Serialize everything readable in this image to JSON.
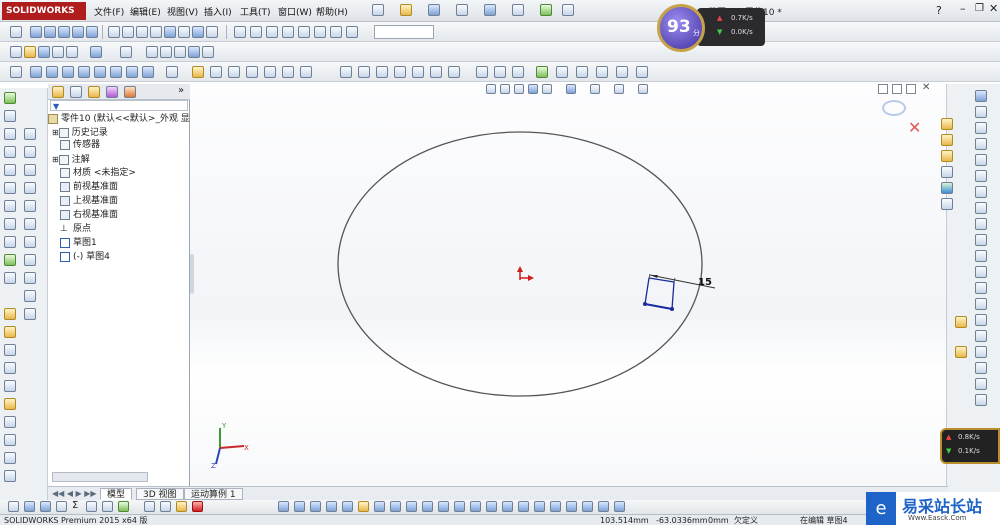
{
  "app": {
    "logo_text": "SOLIDWORKS",
    "window_title": "草图4 ← 零件10 *"
  },
  "menus": [
    "文件(F)",
    "编辑(E)",
    "视图(V)",
    "插入(I)",
    "工具(T)",
    "窗口(W)",
    "帮助(H)"
  ],
  "speed_widget": {
    "score": "93",
    "score_unit": "分",
    "up": "0.7K/s",
    "down": "0.0K/s"
  },
  "speed_widget_2": {
    "up": "0.8K/s",
    "down": "0.1K/s"
  },
  "tree": {
    "filter_label": "",
    "root": "零件10  (默认<<默认>_外观 显",
    "nodes": [
      "历史记录",
      "传感器",
      "注解",
      "材质 <未指定>",
      "前视基准面",
      "上视基准面",
      "右视基准面",
      "原点",
      "草图1",
      "(-) 草图4"
    ]
  },
  "sketch": {
    "dimension_label": "15"
  },
  "bottom_tabs": [
    "模型",
    "3D 视图",
    "运动算例 1"
  ],
  "status": {
    "product": "SOLIDWORKS Premium 2015 x64 版",
    "x": "103.514mm",
    "y": "-63.0336mm",
    "z": "0mm",
    "definition": "欠定义",
    "editing": "在编辑 草图4"
  },
  "watermark": {
    "brand": "易采站长站",
    "url": "Www.Easck.Com"
  },
  "colors": {
    "accent_red": "#b01d1d",
    "sketch_blue": "#1a2aa0",
    "origin_red": "#d21b1b"
  }
}
